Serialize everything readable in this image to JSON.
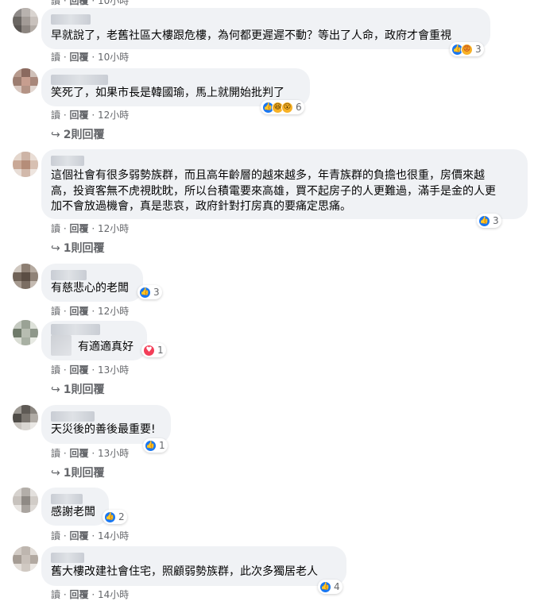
{
  "comments": [
    {
      "text": "早就說了，老舊社區大樓跟危樓，為何都更遲遲不動？等出了人命，政府才會重視",
      "reactions": {
        "count": "3",
        "icons": [
          "like",
          "angry"
        ]
      },
      "actions": {
        "read": "讀",
        "reply": "回覆",
        "dot": "·",
        "time": "10小時"
      },
      "replies": ""
    },
    {
      "text": "笑死了，如果市長是韓國瑜，馬上就開始批判了",
      "reactions": {
        "count": "6",
        "icons": [
          "like",
          "haha",
          "wow"
        ]
      },
      "actions": {
        "read": "讀",
        "reply": "回覆",
        "dot": "·",
        "time": "12小時"
      },
      "replies": "2則回覆"
    },
    {
      "text": "這個社會有很多弱勢族群，而且高年齡層的越來越多，年青族群的負擔也很重，房價來越高，投資客無不虎視眈眈，所以台積電要來高雄，買不起房子的人更難過，滿手是金的人更加不會放過機會，真是悲哀，政府針對打房真的要痛定思痛。",
      "reactions": {
        "count": "3",
        "icons": [
          "like"
        ]
      },
      "actions": {
        "read": "讀",
        "reply": "回覆",
        "dot": "·",
        "time": "12小時"
      },
      "replies": "1則回覆"
    },
    {
      "text": "有慈悲心的老闆",
      "reactions": {
        "count": "3",
        "icons": [
          "like"
        ]
      },
      "actions": {
        "read": "讀",
        "reply": "回覆",
        "dot": "·",
        "time": "12小時"
      },
      "replies": ""
    },
    {
      "text": "有適適真好",
      "reactions": {
        "count": "1",
        "icons": [
          "love"
        ]
      },
      "actions": {
        "read": "讀",
        "reply": "回覆",
        "dot": "·",
        "time": "13小時"
      },
      "replies": "1則回覆"
    },
    {
      "text": "天災後的善後最重要!",
      "reactions": {
        "count": "1",
        "icons": [
          "like"
        ]
      },
      "actions": {
        "read": "讀",
        "reply": "回覆",
        "dot": "·",
        "time": "13小時"
      },
      "replies": "1則回覆"
    },
    {
      "text": "感謝老闆",
      "reactions": {
        "count": "2",
        "icons": [
          "like"
        ]
      },
      "actions": {
        "read": "讀",
        "reply": "回覆",
        "dot": "·",
        "time": "14小時"
      },
      "replies": ""
    },
    {
      "text": "舊大樓改建社會住宅，照顧弱勢族群，此次多獨居老人",
      "reactions": {
        "count": "4",
        "icons": [
          "like"
        ]
      },
      "actions": {
        "read": "讀",
        "reply": "回覆",
        "dot": "·",
        "time": "14小時"
      },
      "replies": ""
    }
  ],
  "top_partial": {
    "read": "讀",
    "reply": "回覆",
    "dot": "·",
    "time": "10小時"
  },
  "icon_glyphs": {
    "like": "👍",
    "angry": "😡",
    "haha": "😆",
    "wow": "😮",
    "love": "♥",
    "reply_arrow": "↪"
  },
  "colors": {
    "like_blue": "#1877f2",
    "bubble_bg": "#f0f2f5",
    "meta_gray": "#65676b",
    "love_red": "#f33e58"
  }
}
